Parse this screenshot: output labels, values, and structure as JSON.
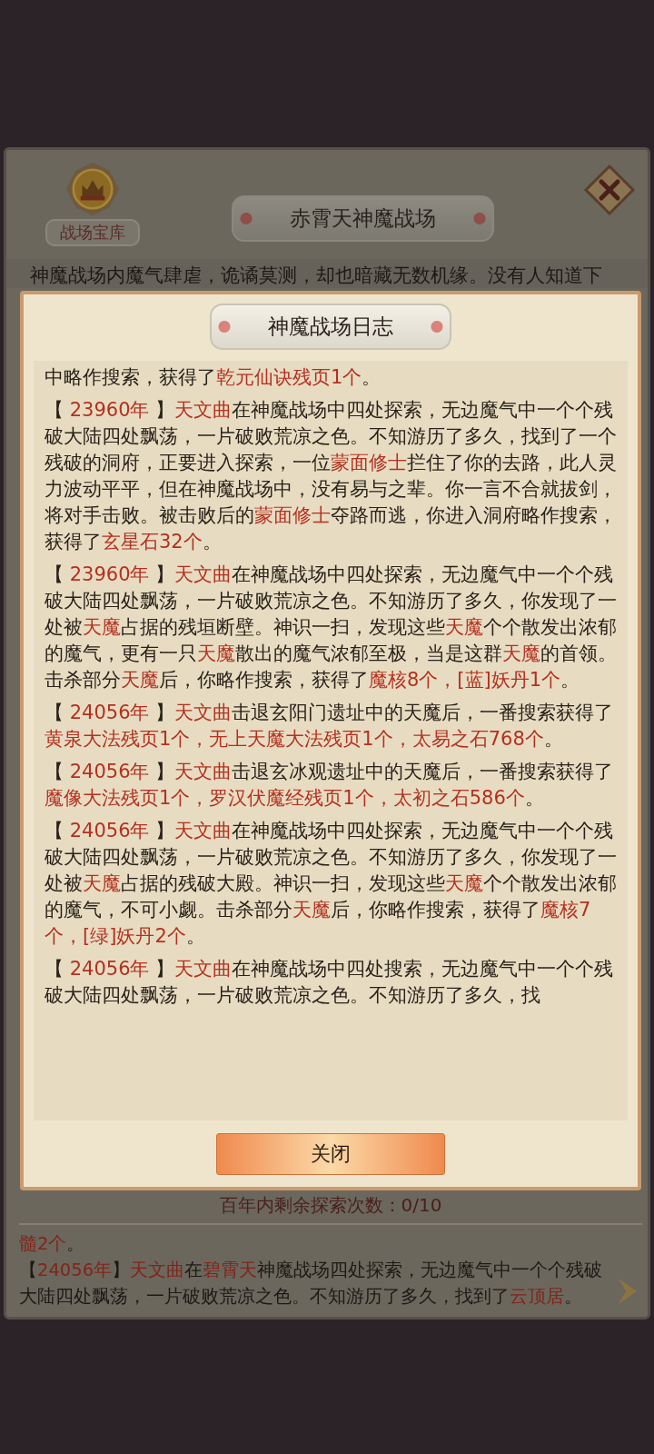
{
  "panel": {
    "treasury_label": "战场宝库",
    "title": "赤霄天神魔战场",
    "description": "神魔战场内魔气肆虐，诡谲莫测，却也暗藏无数机缘。没有人知道下",
    "remaining": "百年内剩余探索次数：0/10",
    "log": [
      {
        "parts": [
          {
            "text": "髓2个",
            "highlight": true
          },
          {
            "text": "。",
            "highlight": false
          }
        ]
      },
      {
        "parts": [
          {
            "text": "【",
            "highlight": false
          },
          {
            "text": "24056年",
            "highlight": true
          },
          {
            "text": "】",
            "highlight": false
          },
          {
            "text": "天文曲",
            "highlight": true
          },
          {
            "text": "在",
            "highlight": false
          },
          {
            "text": "碧霄天",
            "highlight": true
          },
          {
            "text": "神魔战场四处探索，无边魔气中一个个残破大陆四处飘荡，一片破败荒凉之色。不知游历了多久，找到了",
            "highlight": false
          },
          {
            "text": "云顶居",
            "highlight": true
          },
          {
            "text": "。",
            "highlight": false
          }
        ]
      }
    ]
  },
  "modal": {
    "title": "神魔战场日志",
    "close_label": "关闭",
    "entries": [
      {
        "parts": [
          {
            "text": "中略作搜索，获得了",
            "highlight": false
          },
          {
            "text": "乾元仙诀残页1个",
            "highlight": true
          },
          {
            "text": "。",
            "highlight": false
          }
        ]
      },
      {
        "parts": [
          {
            "text": "【 ",
            "highlight": false
          },
          {
            "text": "23960年",
            "highlight": true
          },
          {
            "text": " 】",
            "highlight": false
          },
          {
            "text": "天文曲",
            "highlight": true
          },
          {
            "text": "在神魔战场中四处探索，无边魔气中一个个残破大陆四处飘荡，一片破败荒凉之色。不知游历了多久，找到了一个残破的洞府，正要进入探索，一位",
            "highlight": false
          },
          {
            "text": "蒙面修士",
            "highlight": true
          },
          {
            "text": "拦住了你的去路，此人灵力波动平平，但在神魔战场中，没有易与之辈。你一言不合就拔剑，将对手击败。被击败后的",
            "highlight": false
          },
          {
            "text": "蒙面修士",
            "highlight": true
          },
          {
            "text": "夺路而逃，你进入洞府略作搜索，获得了",
            "highlight": false
          },
          {
            "text": "玄星石32个",
            "highlight": true
          },
          {
            "text": "。",
            "highlight": false
          }
        ]
      },
      {
        "parts": [
          {
            "text": "【 ",
            "highlight": false
          },
          {
            "text": "23960年",
            "highlight": true
          },
          {
            "text": " 】",
            "highlight": false
          },
          {
            "text": "天文曲",
            "highlight": true
          },
          {
            "text": "在神魔战场中四处探索，无边魔气中一个个残破大陆四处飘荡，一片破败荒凉之色。不知游历了多久，你发现了一处被",
            "highlight": false
          },
          {
            "text": "天魔",
            "highlight": true
          },
          {
            "text": "占据的残垣断壁。神识一扫，发现这些",
            "highlight": false
          },
          {
            "text": "天魔",
            "highlight": true
          },
          {
            "text": "个个散发出浓郁的魔气，更有一只",
            "highlight": false
          },
          {
            "text": "天魔",
            "highlight": true
          },
          {
            "text": "散出的魔气浓郁至极，当是这群",
            "highlight": false
          },
          {
            "text": "天魔",
            "highlight": true
          },
          {
            "text": "的首领。击杀部分",
            "highlight": false
          },
          {
            "text": "天魔",
            "highlight": true
          },
          {
            "text": "后，你略作搜索，获得了",
            "highlight": false
          },
          {
            "text": "魔核8个，[蓝]妖丹1个",
            "highlight": true
          },
          {
            "text": "。",
            "highlight": false
          }
        ]
      },
      {
        "parts": [
          {
            "text": "【 ",
            "highlight": false
          },
          {
            "text": "24056年",
            "highlight": true
          },
          {
            "text": " 】",
            "highlight": false
          },
          {
            "text": "天文曲",
            "highlight": true
          },
          {
            "text": "击退玄阳门遗址中的天魔后，一番搜索获得了",
            "highlight": false
          },
          {
            "text": "黄泉大法残页1个，无上天魔大法残页1个，太易之石768个",
            "highlight": true
          },
          {
            "text": "。",
            "highlight": false
          }
        ]
      },
      {
        "parts": [
          {
            "text": "【 ",
            "highlight": false
          },
          {
            "text": "24056年",
            "highlight": true
          },
          {
            "text": " 】",
            "highlight": false
          },
          {
            "text": "天文曲",
            "highlight": true
          },
          {
            "text": "击退玄冰观遗址中的天魔后，一番搜索获得了",
            "highlight": false
          },
          {
            "text": "魔像大法残页1个，罗汉伏魔经残页1个，太初之石586个",
            "highlight": true
          },
          {
            "text": "。",
            "highlight": false
          }
        ]
      },
      {
        "parts": [
          {
            "text": "【 ",
            "highlight": false
          },
          {
            "text": "24056年",
            "highlight": true
          },
          {
            "text": " 】",
            "highlight": false
          },
          {
            "text": "天文曲",
            "highlight": true
          },
          {
            "text": "在神魔战场中四处探索，无边魔气中一个个残破大陆四处飘荡，一片破败荒凉之色。不知游历了多久，你发现了一处被",
            "highlight": false
          },
          {
            "text": "天魔",
            "highlight": true
          },
          {
            "text": "占据的残破大殿。神识一扫，发现这些",
            "highlight": false
          },
          {
            "text": "天魔",
            "highlight": true
          },
          {
            "text": "个个散发出浓郁的魔气，不可小觑。击杀部分",
            "highlight": false
          },
          {
            "text": "天魔",
            "highlight": true
          },
          {
            "text": "后，你略作搜索，获得了",
            "highlight": false
          },
          {
            "text": "魔核7个，[绿]妖丹2个",
            "highlight": true
          },
          {
            "text": "。",
            "highlight": false
          }
        ]
      },
      {
        "parts": [
          {
            "text": "【 ",
            "highlight": false
          },
          {
            "text": "24056年",
            "highlight": true
          },
          {
            "text": " 】",
            "highlight": false
          },
          {
            "text": "天文曲",
            "highlight": true
          },
          {
            "text": "在神魔战场中四处搜索，无边魔气中一个个残破大陆四处飘荡，一片破败荒凉之色。不知游历了多久，找",
            "highlight": false
          }
        ]
      }
    ]
  }
}
